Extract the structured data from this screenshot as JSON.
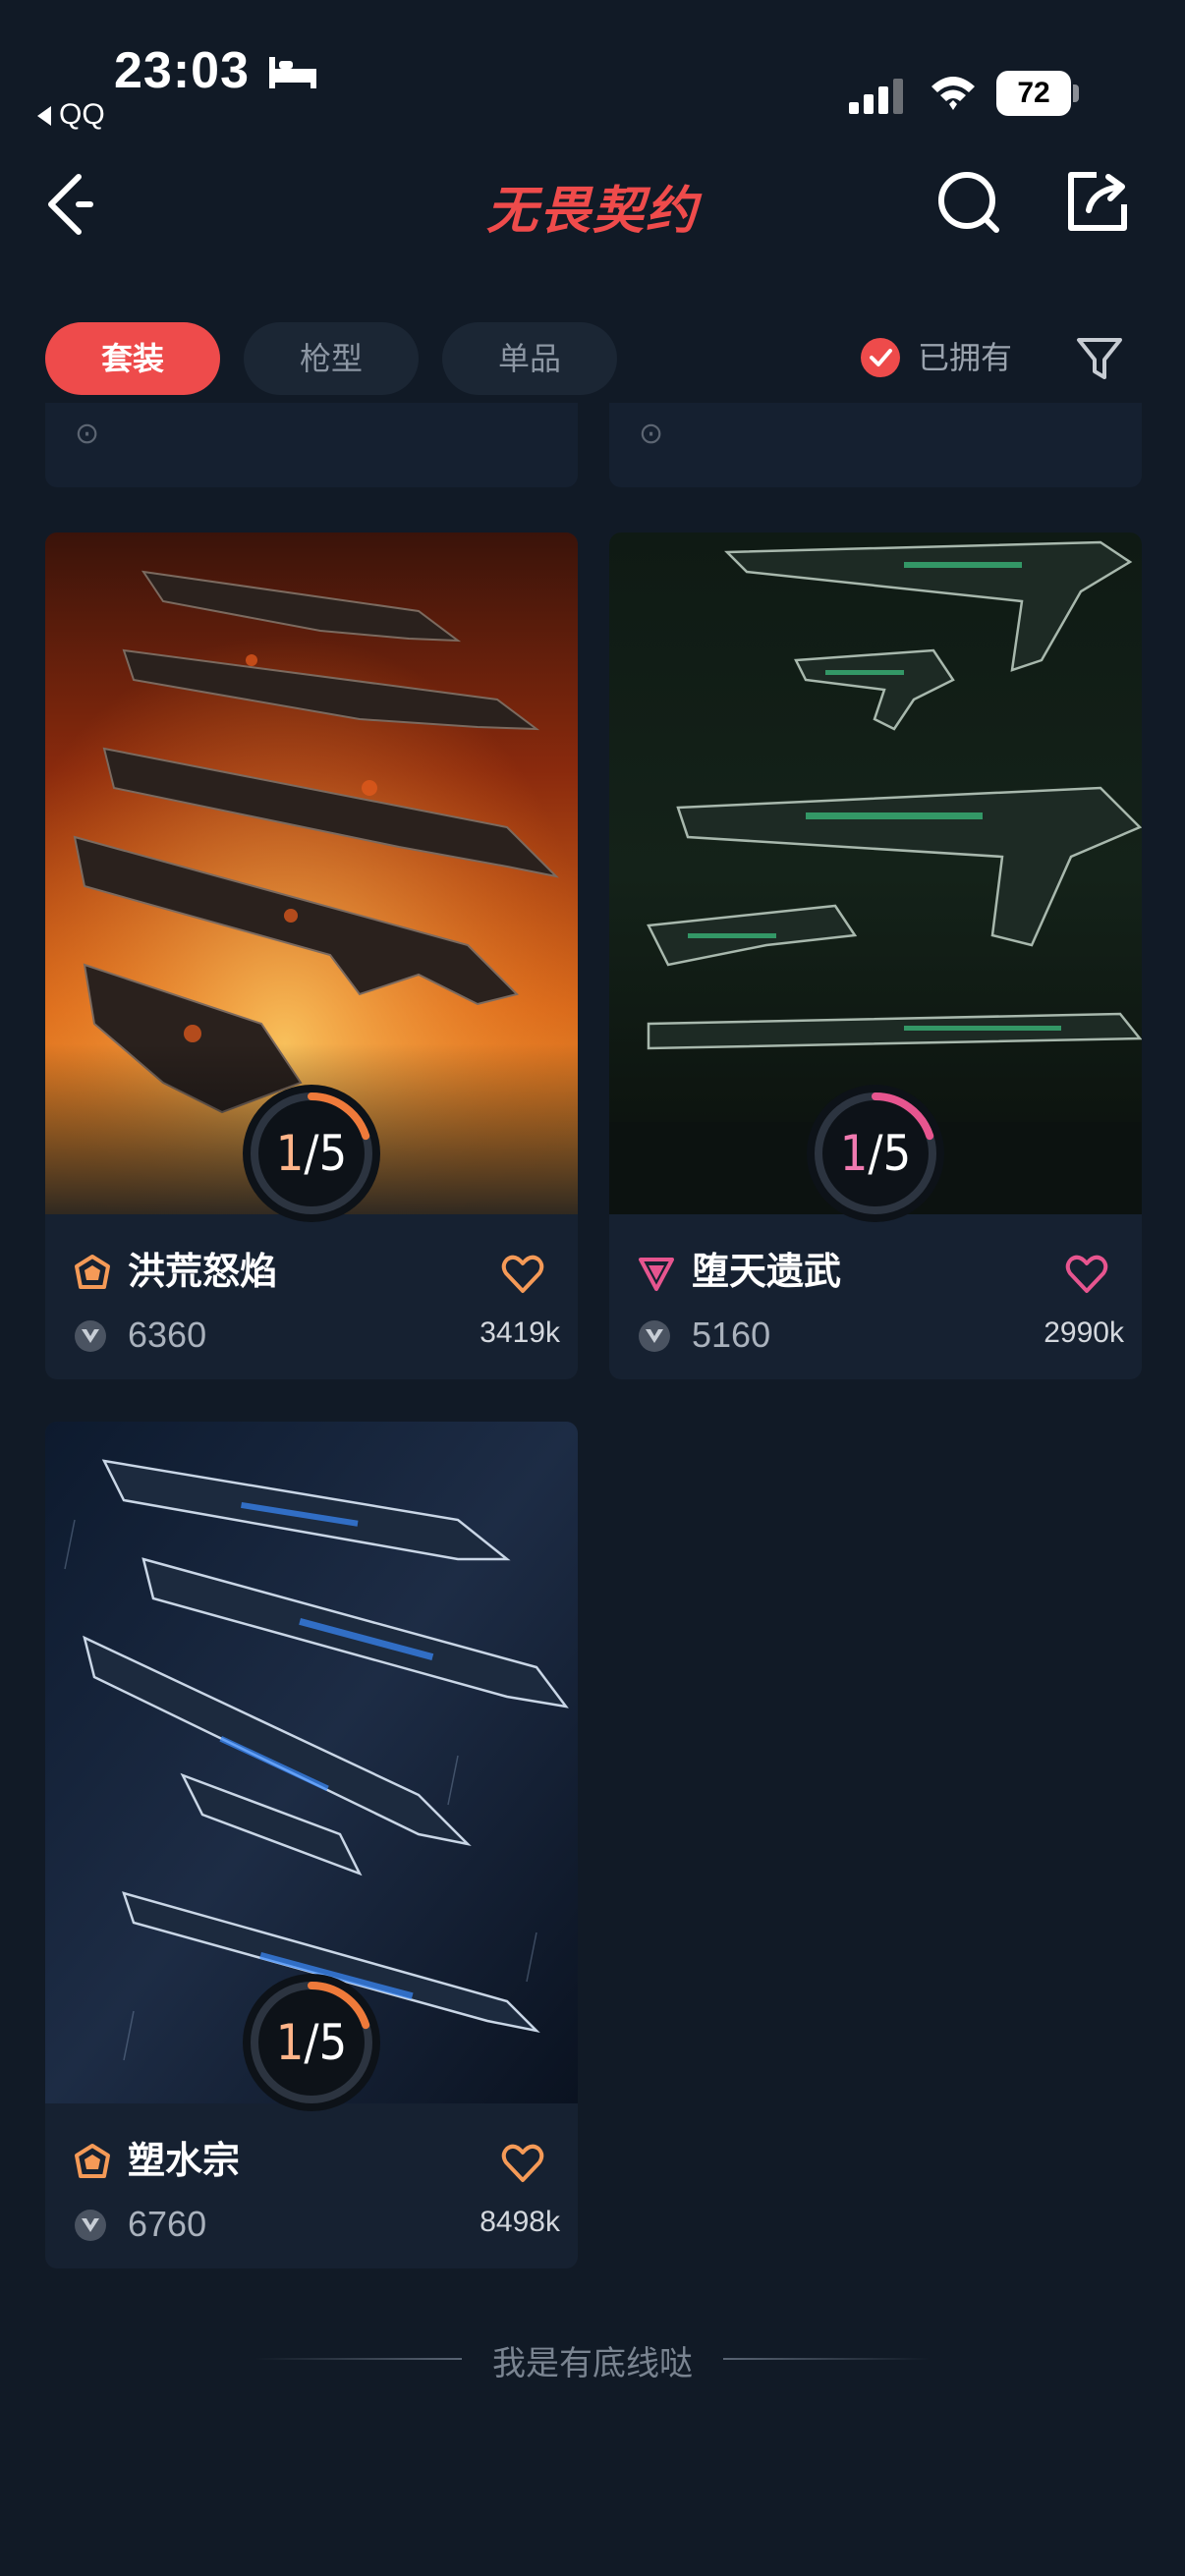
{
  "status_bar": {
    "time": "23:03",
    "back_app": "QQ",
    "battery": "72"
  },
  "header": {
    "title": "无畏契约"
  },
  "filters": {
    "tabs": [
      {
        "label": "套装",
        "active": true
      },
      {
        "label": "枪型",
        "active": false
      },
      {
        "label": "单品",
        "active": false
      }
    ],
    "owned_label": "已拥有",
    "owned_checked": true
  },
  "cards": [
    {
      "name": "洪荒怒焰",
      "price": "6360",
      "count": "3419k",
      "owned": "1",
      "total": "5",
      "progress": 0.2,
      "rank_color": "#f59a57",
      "heart_color": "#f59a57"
    },
    {
      "name": "堕天遗武",
      "price": "5160",
      "count": "2990k",
      "owned": "1",
      "total": "5",
      "progress": 0.2,
      "rank_color": "#e7558f",
      "heart_color": "#e7558f"
    },
    {
      "name": "塑水宗",
      "price": "6760",
      "count": "8498k",
      "owned": "1",
      "total": "5",
      "progress": 0.2,
      "rank_color": "#f59a57",
      "heart_color": "#f59a57"
    }
  ],
  "footer": {
    "text": "我是有底线哒"
  },
  "colors": {
    "accent": "#ee4b4b",
    "background": "#111a26",
    "card": "#162131"
  }
}
